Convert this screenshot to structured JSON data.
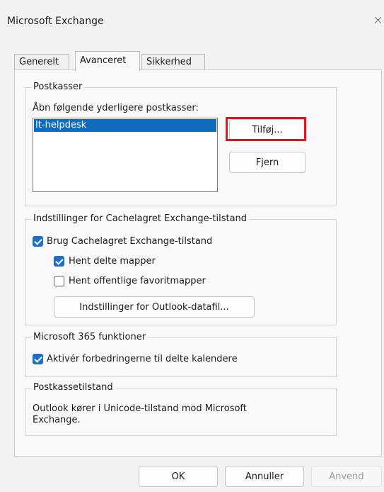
{
  "window": {
    "title": "Microsoft Exchange",
    "close_glyph": "×"
  },
  "tabs": [
    {
      "label": "Generelt",
      "active": false
    },
    {
      "label": "Avanceret",
      "active": true
    },
    {
      "label": "Sikkerhed",
      "active": false
    }
  ],
  "mailboxes": {
    "legend": "Postkasser",
    "prompt": "Åbn følgende yderligere postkasser:",
    "items": [
      "It-helpdesk"
    ],
    "add_label": "Tilføj...",
    "remove_label": "Fjern"
  },
  "cache": {
    "legend": "Indstillinger for Cachelagret Exchange-tilstand",
    "use_cached": {
      "label": "Brug Cachelagret Exchange-tilstand",
      "checked": true
    },
    "shared_folders": {
      "label": "Hent delte mapper",
      "checked": true
    },
    "public_favorites": {
      "label": "Hent offentlige favoritmapper",
      "checked": false
    },
    "datafile_button": "Indstillinger for Outlook-datafil..."
  },
  "m365": {
    "legend": "Microsoft 365 funktioner",
    "shared_calendars": {
      "label": "Aktivér forbedringerne til delte kalendere",
      "checked": true
    }
  },
  "mailbox_mode": {
    "legend": "Postkassetilstand",
    "text_line1": "Outlook kører i Unicode-tilstand mod Microsoft",
    "text_line2": "Exchange."
  },
  "footer": {
    "ok": "OK",
    "cancel": "Annuller",
    "apply": "Anvend"
  },
  "colors": {
    "accent": "#1f6fc4",
    "selection": "#0f6cbd",
    "highlight_box": "#e0141b"
  }
}
